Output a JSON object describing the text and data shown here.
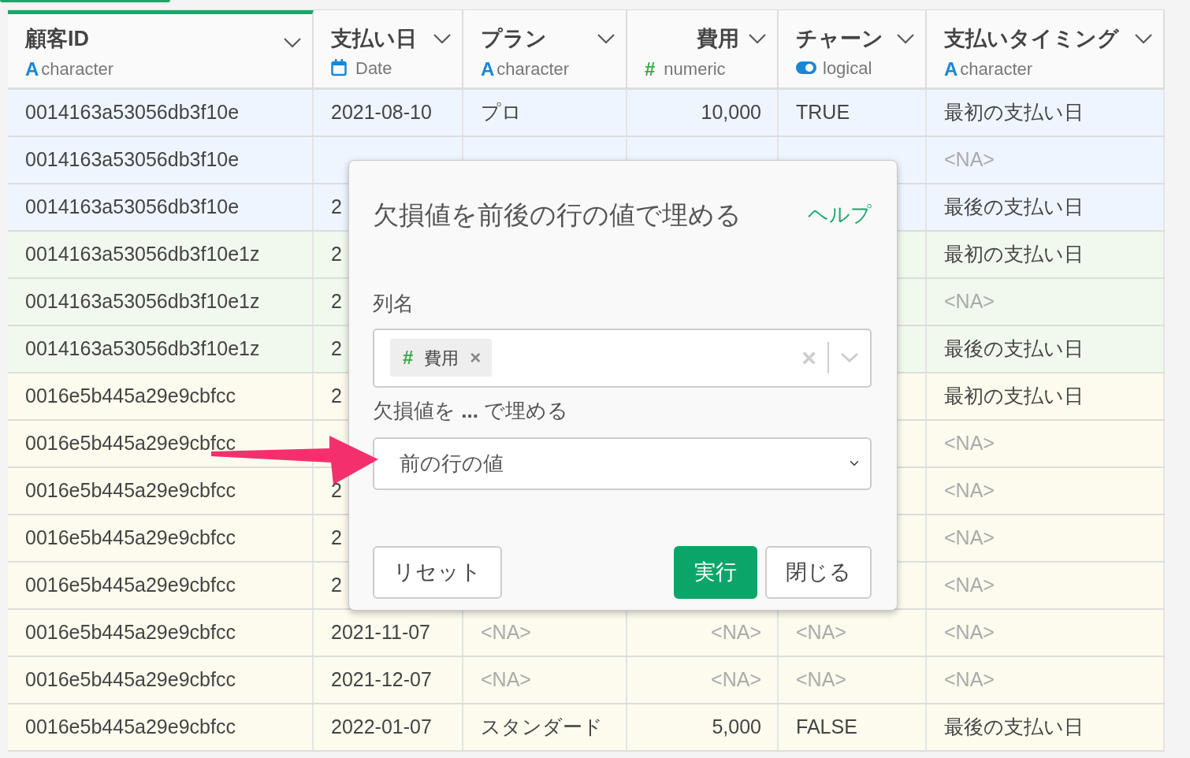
{
  "columns": [
    {
      "name": "顧客ID",
      "kind": "character",
      "icon": "A",
      "type_label": "character",
      "selected": true
    },
    {
      "name": "支払い日",
      "kind": "date",
      "type_label": "Date",
      "selected": false
    },
    {
      "name": "プラン",
      "kind": "character",
      "icon": "A",
      "type_label": "character",
      "selected": false
    },
    {
      "name": "費用",
      "kind": "numeric",
      "icon": "#",
      "type_label": "numeric",
      "selected": false
    },
    {
      "name": "チャーン",
      "kind": "logical",
      "type_label": "logical",
      "selected": false
    },
    {
      "name": "支払いタイミング",
      "kind": "character",
      "icon": "A",
      "type_label": "character",
      "selected": false
    }
  ],
  "rows": [
    {
      "color": "#eef5fe",
      "cells": [
        "0014163a53056db3f10e",
        "2021-08-10",
        "プロ",
        "10,000",
        "TRUE",
        "最初の支払い日"
      ]
    },
    {
      "color": "#eef5fe",
      "cells": [
        "0014163a53056db3f10e",
        null,
        null,
        null,
        null,
        {
          "text": "<NA>",
          "missing": true
        }
      ]
    },
    {
      "color": "#eef5fe",
      "cells": [
        "0014163a53056db3f10e",
        "2",
        null,
        null,
        null,
        "最後の支払い日"
      ]
    },
    {
      "color": "#f1f8ee",
      "cells": [
        "0014163a53056db3f10e1z",
        "2",
        null,
        null,
        null,
        "最初の支払い日"
      ]
    },
    {
      "color": "#f1f8ee",
      "cells": [
        "0014163a53056db3f10e1z",
        "2",
        null,
        null,
        null,
        {
          "text": "<NA>",
          "missing": true
        }
      ]
    },
    {
      "color": "#f1f8ee",
      "cells": [
        "0014163a53056db3f10e1z",
        "2",
        null,
        null,
        null,
        "最後の支払い日"
      ]
    },
    {
      "color": "#fcfbee",
      "cells": [
        "0016e5b445a29e9cbfcc",
        "2",
        null,
        null,
        null,
        "最初の支払い日"
      ]
    },
    {
      "color": "#fcfbee",
      "cells": [
        "0016e5b445a29e9cbfcc",
        null,
        null,
        null,
        null,
        {
          "text": "<NA>",
          "missing": true
        }
      ]
    },
    {
      "color": "#fcfbee",
      "cells": [
        "0016e5b445a29e9cbfcc",
        "2",
        null,
        null,
        null,
        {
          "text": "<NA>",
          "missing": true
        }
      ]
    },
    {
      "color": "#fcfbee",
      "cells": [
        "0016e5b445a29e9cbfcc",
        "2",
        null,
        null,
        null,
        {
          "text": "<NA>",
          "missing": true
        }
      ]
    },
    {
      "color": "#fcfbee",
      "cells": [
        "0016e5b445a29e9cbfcc",
        "2",
        null,
        null,
        null,
        {
          "text": "<NA>",
          "missing": true
        }
      ]
    },
    {
      "color": "#fcfbee",
      "cells": [
        "0016e5b445a29e9cbfcc",
        "2021-11-07",
        {
          "text": "<NA>",
          "missing": true
        },
        {
          "text": "<NA>",
          "missing": true
        },
        {
          "text": "<NA>",
          "missing": true
        },
        {
          "text": "<NA>",
          "missing": true
        }
      ]
    },
    {
      "color": "#fcfbee",
      "cells": [
        "0016e5b445a29e9cbfcc",
        "2021-12-07",
        {
          "text": "<NA>",
          "missing": true
        },
        {
          "text": "<NA>",
          "missing": true
        },
        {
          "text": "<NA>",
          "missing": true
        },
        {
          "text": "<NA>",
          "missing": true
        }
      ]
    },
    {
      "color": "#fcfbee",
      "cells": [
        "0016e5b445a29e9cbfcc",
        "2022-01-07",
        "スタンダード",
        "5,000",
        "FALSE",
        "最後の支払い日"
      ]
    }
  ],
  "dialog": {
    "title": "欠損値を前後の行の値で埋める",
    "help": "ヘルプ",
    "column_label": "列名",
    "tags": [
      {
        "icon": "#",
        "label": "費用",
        "remove": "×"
      }
    ],
    "clear": "×",
    "fill_label": "欠損値を **...** で埋める",
    "fill_value": "前の行の値",
    "buttons": [
      {
        "label": "リセット",
        "kind": "secondary"
      },
      {
        "label": "実行",
        "kind": "primary"
      },
      {
        "label": "閉じる",
        "kind": "secondary"
      }
    ]
  }
}
